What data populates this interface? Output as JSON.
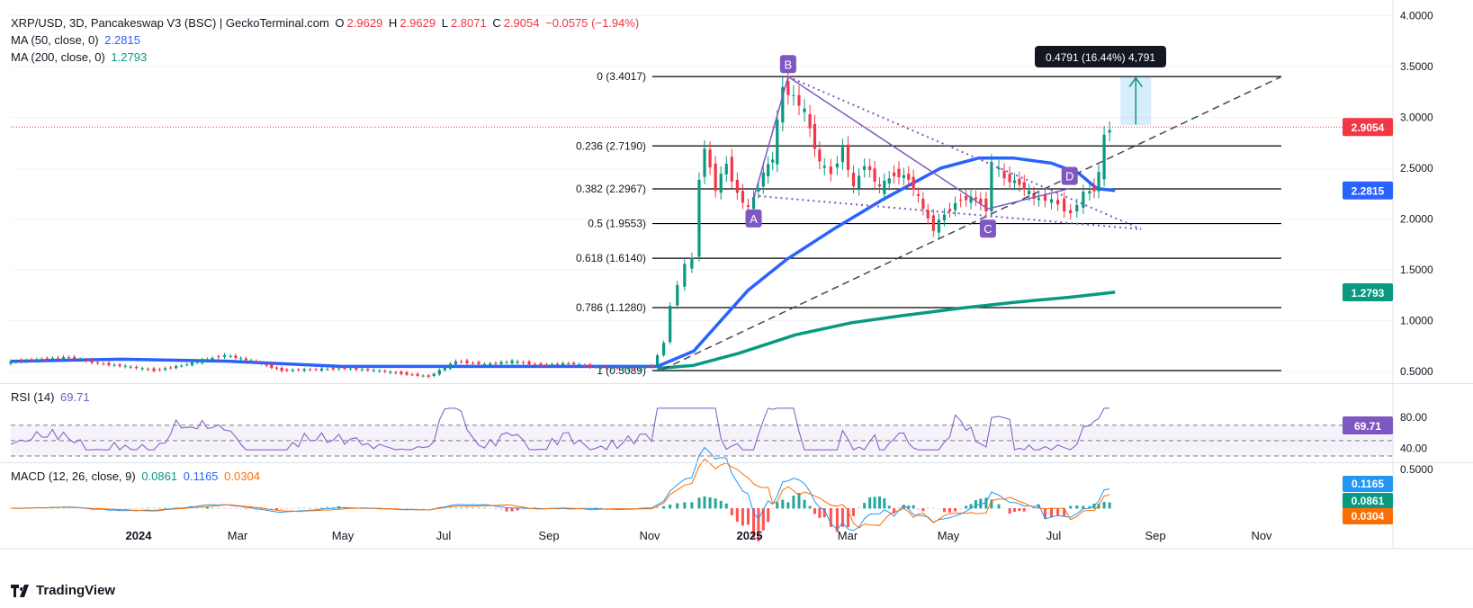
{
  "header": {
    "symbol": "XRP/USD, 3D, Pancakeswap V3 (BSC) | GeckoTerminal.com",
    "o_label": "O",
    "o_val": "2.9629",
    "h_label": "H",
    "h_val": "2.9629",
    "l_label": "L",
    "l_val": "2.8071",
    "c_label": "C",
    "c_val": "2.9054",
    "change": "−0.0575 (−1.94%)",
    "ma50_label": "MA (50, close, 0)",
    "ma50_val": "2.2815",
    "ma200_label": "MA (200, close, 0)",
    "ma200_val": "1.2793"
  },
  "rsi": {
    "label": "RSI (14)",
    "value": "69.71",
    "ticks": [
      "80.00",
      "40.00"
    ]
  },
  "macd": {
    "label": "MACD (12, 26, close, 9)",
    "v1": "0.0861",
    "v2": "0.1165",
    "v3": "0.0304",
    "tick": "0.5000"
  },
  "branding": {
    "name": "TradingView"
  },
  "colors": {
    "up": "#089981",
    "down": "#f23645",
    "ma50": "#2962ff",
    "ma200": "#089981",
    "pattern": "#7e57c2",
    "rsi": "#7e57c2",
    "macd": "#2196f3",
    "signal": "#ff6d00"
  },
  "chart_data": {
    "type": "candlestick",
    "title": "XRP/USD, 3D, Pancakeswap V3 (BSC)",
    "y_ticks": [
      "4.0000",
      "3.5000",
      "3.0000",
      "2.5000",
      "2.0000",
      "1.5000",
      "1.0000",
      "0.5000"
    ],
    "x_ticks": [
      "2024",
      "Mar",
      "May",
      "Jul",
      "Sep",
      "Nov",
      "2025",
      "Mar",
      "May",
      "Jul",
      "Sep",
      "Nov"
    ],
    "price_badges": [
      {
        "value": "2.9054",
        "color": "#f23645"
      },
      {
        "value": "2.2815",
        "color": "#2962ff"
      },
      {
        "value": "1.2793",
        "color": "#089981"
      }
    ],
    "fib_levels": [
      {
        "label": "0 (3.4017)",
        "price": 3.4017
      },
      {
        "label": "0.236 (2.7190)",
        "price": 2.719
      },
      {
        "label": "0.382 (2.2967)",
        "price": 2.2967
      },
      {
        "label": "0.5 (1.9553)",
        "price": 1.9553
      },
      {
        "label": "0.618 (1.6140)",
        "price": 1.614
      },
      {
        "label": "0.786 (1.1280)",
        "price": 1.128
      },
      {
        "label": "1 (0.5089)",
        "price": 0.5089
      }
    ],
    "pattern_points": [
      {
        "label": "A",
        "date": "2024-12-28",
        "price": 2.2
      },
      {
        "label": "B",
        "date": "2025-01-16",
        "price": 3.4
      },
      {
        "label": "C",
        "date": "2025-05-06",
        "price": 2.1
      },
      {
        "label": "D",
        "date": "2025-06-20",
        "price": 2.3
      }
    ],
    "measure": {
      "text": "0.4791 (16.44%) 4,791"
    },
    "price_path": [
      [
        "2023-11-15",
        0.59
      ],
      [
        "2023-12-05",
        0.62
      ],
      [
        "2023-12-20",
        0.64
      ],
      [
        "2024-01-05",
        0.58
      ],
      [
        "2024-01-20",
        0.55
      ],
      [
        "2024-02-05",
        0.51
      ],
      [
        "2024-02-20",
        0.56
      ],
      [
        "2024-03-05",
        0.62
      ],
      [
        "2024-03-15",
        0.66
      ],
      [
        "2024-04-01",
        0.59
      ],
      [
        "2024-04-15",
        0.51
      ],
      [
        "2024-05-01",
        0.52
      ],
      [
        "2024-05-20",
        0.53
      ],
      [
        "2024-06-05",
        0.51
      ],
      [
        "2024-06-20",
        0.48
      ],
      [
        "2024-07-05",
        0.45
      ],
      [
        "2024-07-20",
        0.6
      ],
      [
        "2024-08-05",
        0.57
      ],
      [
        "2024-08-20",
        0.6
      ],
      [
        "2024-09-05",
        0.56
      ],
      [
        "2024-09-20",
        0.58
      ],
      [
        "2024-10-05",
        0.54
      ],
      [
        "2024-10-20",
        0.53
      ],
      [
        "2024-11-05",
        0.55
      ],
      [
        "2024-11-12",
        0.78
      ],
      [
        "2024-11-16",
        1.15
      ],
      [
        "2024-11-20",
        1.35
      ],
      [
        "2024-11-24",
        1.55
      ],
      [
        "2024-11-28",
        1.6
      ],
      [
        "2024-12-01",
        2.4
      ],
      [
        "2024-12-04",
        2.7
      ],
      [
        "2024-12-10",
        2.3
      ],
      [
        "2024-12-16",
        2.55
      ],
      [
        "2024-12-22",
        2.25
      ],
      [
        "2024-12-28",
        2.1
      ],
      [
        "2025-01-05",
        2.45
      ],
      [
        "2025-01-10",
        2.6
      ],
      [
        "2025-01-16",
        3.3
      ],
      [
        "2025-01-22",
        3.2
      ],
      [
        "2025-01-28",
        3.05
      ],
      [
        "2025-02-05",
        2.55
      ],
      [
        "2025-02-12",
        2.45
      ],
      [
        "2025-02-18",
        2.7
      ],
      [
        "2025-02-24",
        2.3
      ],
      [
        "2025-03-02",
        2.55
      ],
      [
        "2025-03-10",
        2.3
      ],
      [
        "2025-03-18",
        2.45
      ],
      [
        "2025-03-26",
        2.4
      ],
      [
        "2025-04-03",
        2.1
      ],
      [
        "2025-04-09",
        1.9
      ],
      [
        "2025-04-15",
        2.05
      ],
      [
        "2025-04-24",
        2.2
      ],
      [
        "2025-05-02",
        2.2
      ],
      [
        "2025-05-08",
        2.1
      ],
      [
        "2025-05-12",
        2.55
      ],
      [
        "2025-05-18",
        2.4
      ],
      [
        "2025-05-26",
        2.35
      ],
      [
        "2025-06-03",
        2.2
      ],
      [
        "2025-06-10",
        2.2
      ],
      [
        "2025-06-17",
        2.15
      ],
      [
        "2025-06-24",
        2.05
      ],
      [
        "2025-07-01",
        2.25
      ],
      [
        "2025-07-06",
        2.3
      ],
      [
        "2025-07-09",
        2.45
      ],
      [
        "2025-07-12",
        2.8
      ],
      [
        "2025-07-15",
        2.9
      ]
    ],
    "ma50_path": [
      [
        "2023-11-15",
        0.6
      ],
      [
        "2024-01-15",
        0.62
      ],
      [
        "2024-03-15",
        0.6
      ],
      [
        "2024-05-15",
        0.55
      ],
      [
        "2024-07-15",
        0.55
      ],
      [
        "2024-09-15",
        0.55
      ],
      [
        "2024-11-05",
        0.55
      ],
      [
        "2024-11-25",
        0.7
      ],
      [
        "2024-12-10",
        1.0
      ],
      [
        "2024-12-25",
        1.3
      ],
      [
        "2025-01-15",
        1.6
      ],
      [
        "2025-02-10",
        1.9
      ],
      [
        "2025-03-10",
        2.2
      ],
      [
        "2025-04-10",
        2.5
      ],
      [
        "2025-05-01",
        2.6
      ],
      [
        "2025-05-20",
        2.6
      ],
      [
        "2025-06-10",
        2.55
      ],
      [
        "2025-06-25",
        2.45
      ],
      [
        "2025-07-05",
        2.3
      ],
      [
        "2025-07-15",
        2.28
      ]
    ],
    "ma200_path": [
      [
        "2024-11-05",
        0.53
      ],
      [
        "2024-11-25",
        0.56
      ],
      [
        "2024-12-20",
        0.68
      ],
      [
        "2025-01-20",
        0.86
      ],
      [
        "2025-02-20",
        0.98
      ],
      [
        "2025-03-20",
        1.05
      ],
      [
        "2025-04-20",
        1.12
      ],
      [
        "2025-05-20",
        1.18
      ],
      [
        "2025-06-20",
        1.23
      ],
      [
        "2025-07-15",
        1.28
      ]
    ]
  }
}
